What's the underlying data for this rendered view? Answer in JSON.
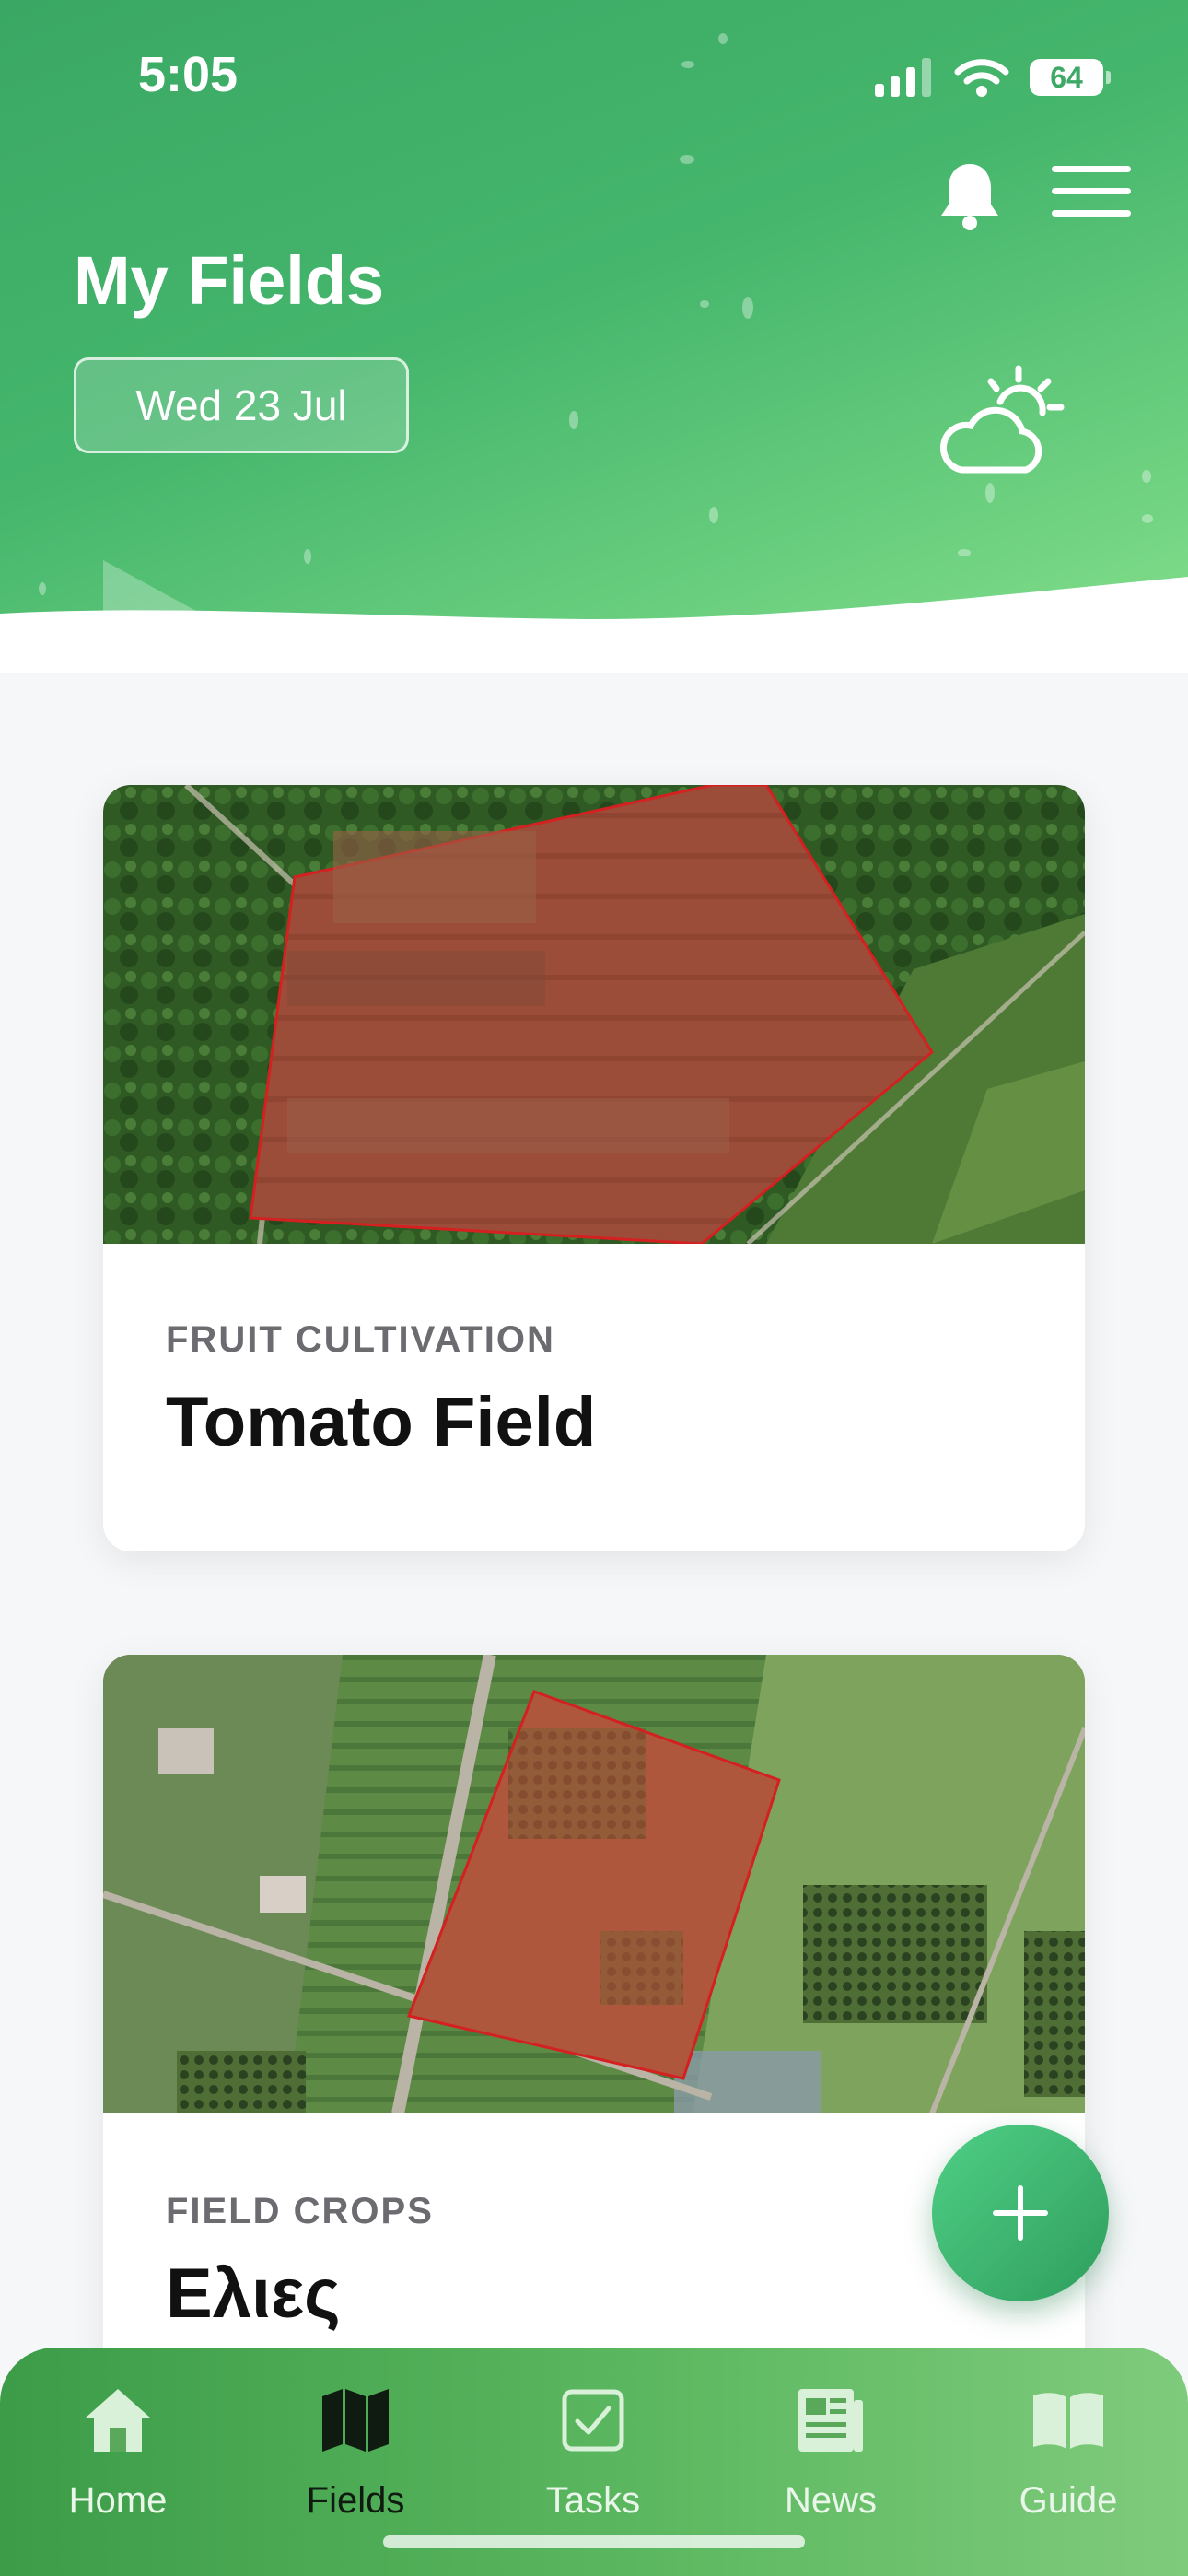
{
  "status_bar": {
    "time": "5:05",
    "battery": "64"
  },
  "header": {
    "title": "My Fields",
    "date": "Wed 23 Jul"
  },
  "fields": [
    {
      "category": "FRUIT CULTIVATION",
      "name": "Tomato Field"
    },
    {
      "category": "FIELD CROPS",
      "name": "Ελιες"
    }
  ],
  "tabs": [
    {
      "label": "Home",
      "icon": "home-icon"
    },
    {
      "label": "Fields",
      "icon": "map-icon",
      "active": true
    },
    {
      "label": "Tasks",
      "icon": "checkbox-icon"
    },
    {
      "label": "News",
      "icon": "newspaper-icon"
    },
    {
      "label": "Guide",
      "icon": "book-icon"
    }
  ],
  "colors": {
    "accent": "#3aa864",
    "fab": "#3cb873",
    "field_outline": "#d42020"
  }
}
